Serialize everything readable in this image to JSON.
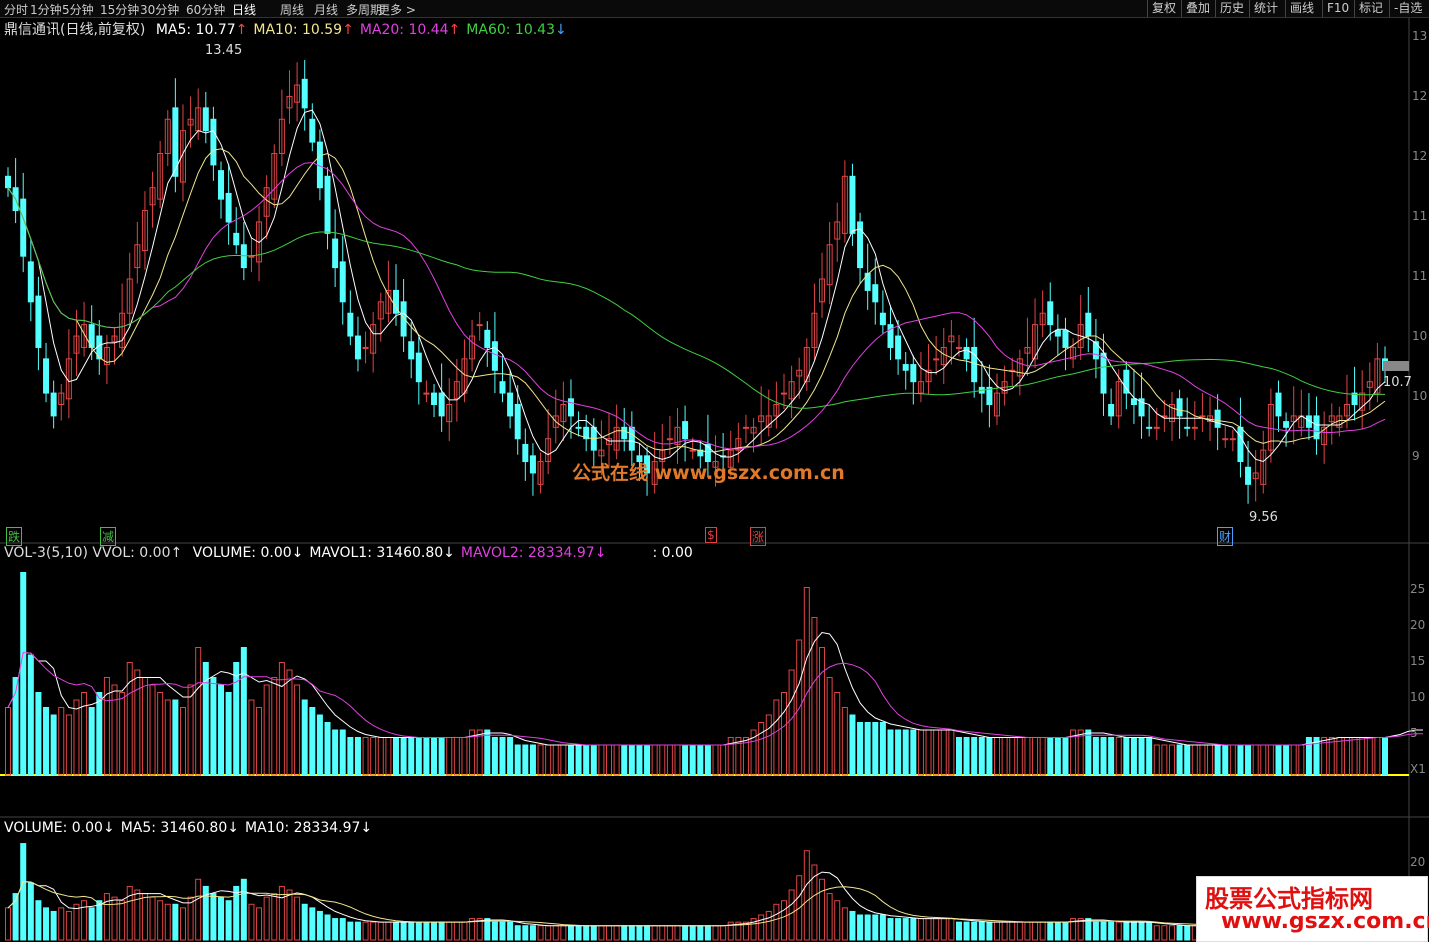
{
  "toolbar": {
    "periods": [
      "分时",
      "1分钟",
      "5分钟",
      "15分钟",
      "30分钟",
      "60分钟",
      "日线",
      "周线",
      "月线",
      "多周期",
      "更多 >"
    ],
    "active_period": "日线",
    "right_buttons": [
      "复权",
      "叠加",
      "历史",
      "统计",
      "画线",
      "F10",
      "标记",
      "-自选"
    ]
  },
  "main_panel": {
    "title": "鼎信通讯(日线,前复权)",
    "ma": [
      {
        "label": "MA5: 10.77",
        "arrow": "↑",
        "color": "#ffffff"
      },
      {
        "label": "MA10: 10.59",
        "arrow": "↑",
        "color": "#f0e68c"
      },
      {
        "label": "MA20: 10.44",
        "arrow": "↑",
        "color": "#e040e0"
      },
      {
        "label": "MA60: 10.43",
        "arrow": "↓",
        "color": "#40d040"
      }
    ],
    "high_label": "13.45",
    "low_label": "9.56",
    "last_label": "10.7",
    "badges": [
      {
        "text": "跌",
        "color": "#40c040"
      },
      {
        "text": "减",
        "color": "#40c040"
      },
      {
        "text": "$",
        "color": "#e04040"
      },
      {
        "text": "涨",
        "color": "#e04040"
      },
      {
        "text": "财",
        "color": "#4aa0ff"
      }
    ],
    "y_ticks": [
      "13",
      "12",
      "12",
      "11",
      "11",
      "10",
      "10",
      "9"
    ]
  },
  "watermark": "公式在线 www.gszx.com.cn",
  "vol3_panel": {
    "title": "VOL-3(5,10) VVOL: 0.00↑",
    "items": [
      {
        "label": "VOLUME: 0.00↓",
        "color": "#ffffff"
      },
      {
        "label": "MAVOL1: 31460.80↓",
        "color": "#ffffff"
      },
      {
        "label": "MAVOL2: 28334.97↓",
        "color": "#e040e0"
      },
      {
        "label": ": 0.00",
        "color": "#ffffff"
      }
    ],
    "y_ticks": [
      "25",
      "20",
      "15",
      "10",
      "5",
      "X1"
    ]
  },
  "vol_panel": {
    "items": [
      {
        "label": "VOLUME: 0.00↓",
        "color": "#ffffff"
      },
      {
        "label": "MA5: 31460.80↓",
        "color": "#ffffff"
      },
      {
        "label": "MA10: 28334.97↓",
        "color": "#ffffff"
      }
    ],
    "y_ticks": [
      "20"
    ]
  },
  "brand": {
    "line1": "股票公式指标网",
    "line2": "www.gszx.com.cn"
  },
  "chart_data": {
    "type": "candlestick",
    "price_ylim": [
      9.3,
      13.7
    ],
    "close": [
      12.3,
      12.1,
      11.7,
      11.3,
      10.9,
      10.5,
      10.3,
      10.5,
      10.8,
      11.0,
      11.1,
      10.9,
      10.8,
      10.9,
      11.0,
      11.2,
      11.5,
      11.8,
      12.1,
      12.3,
      12.6,
      12.9,
      12.4,
      12.8,
      12.9,
      13.0,
      12.8,
      12.5,
      12.2,
      12.0,
      11.8,
      11.6,
      11.7,
      12.0,
      12.3,
      12.6,
      12.9,
      13.1,
      13.2,
      13.0,
      12.7,
      12.3,
      11.9,
      11.6,
      11.3,
      11.0,
      10.8,
      10.9,
      11.1,
      11.3,
      11.4,
      11.2,
      11.0,
      10.8,
      10.6,
      10.5,
      10.4,
      10.3,
      10.4,
      10.6,
      10.8,
      11.0,
      11.1,
      10.9,
      10.7,
      10.5,
      10.3,
      10.1,
      9.9,
      9.8,
      9.9,
      10.1,
      10.3,
      10.4,
      10.3,
      10.2,
      10.1,
      10.0,
      10.0,
      10.1,
      10.2,
      10.1,
      10.0,
      9.9,
      9.8,
      9.9,
      10.0,
      10.1,
      10.2,
      10.1,
      10.0,
      9.95,
      9.9,
      9.9,
      9.95,
      10.0,
      10.1,
      10.2,
      10.2,
      10.3,
      10.3,
      10.4,
      10.5,
      10.6,
      10.7,
      10.9,
      11.2,
      11.5,
      11.8,
      12.0,
      12.4,
      11.9,
      11.6,
      11.4,
      11.3,
      11.1,
      10.9,
      10.8,
      10.7,
      10.6,
      10.6,
      10.7,
      10.8,
      10.9,
      11.0,
      10.9,
      10.8,
      10.6,
      10.5,
      10.4,
      10.5,
      10.6,
      10.7,
      10.8,
      10.9,
      11.1,
      11.2,
      11.1,
      11.0,
      10.9,
      10.9,
      11.1,
      11.0,
      10.8,
      10.5,
      10.3,
      10.6,
      10.5,
      10.4,
      10.3,
      10.2,
      10.2,
      10.3,
      10.4,
      10.3,
      10.2,
      10.2,
      10.3,
      10.3,
      10.2,
      10.1,
      10.1,
      9.9,
      9.7,
      9.8,
      10.0,
      10.4,
      10.3,
      10.2,
      10.3,
      10.3,
      10.2,
      10.1,
      10.2,
      10.3,
      10.3,
      10.4,
      10.4,
      10.5,
      10.6,
      10.8,
      10.7
    ],
    "ma_series": [
      {
        "name": "MA5",
        "color": "#ffffff",
        "window": 5
      },
      {
        "name": "MA10",
        "color": "#f0e68c",
        "window": 10
      },
      {
        "name": "MA20",
        "color": "#e040e0",
        "window": 20
      },
      {
        "name": "MA60",
        "color": "#40d040",
        "window": 60
      }
    ],
    "volume": [
      9,
      13,
      27,
      16,
      11,
      9,
      8,
      9,
      8,
      10,
      11,
      9,
      11,
      13,
      12,
      11,
      15,
      14,
      13,
      12,
      11,
      10,
      10,
      9,
      12,
      17,
      15,
      13,
      12,
      11,
      15,
      17,
      10,
      9,
      12,
      13,
      15,
      14,
      12,
      10,
      9,
      8,
      7,
      6,
      6,
      5,
      5,
      5,
      5,
      5,
      5,
      5,
      5,
      5,
      5,
      5,
      5,
      5,
      5,
      5,
      5,
      6,
      6,
      6,
      5,
      5,
      5,
      4,
      4,
      4,
      4,
      4,
      4,
      4,
      4,
      4,
      4,
      4,
      4,
      4,
      4,
      4,
      4,
      4,
      4,
      4,
      4,
      4,
      4,
      4,
      4,
      4,
      4,
      4,
      4,
      5,
      5,
      5,
      6,
      7,
      8,
      10,
      11,
      14,
      18,
      25,
      21,
      17,
      13,
      11,
      9,
      8,
      7,
      7,
      7,
      7,
      6,
      6,
      6,
      6,
      6,
      6,
      6,
      6,
      6,
      5,
      5,
      5,
      5,
      5,
      5,
      5,
      5,
      5,
      5,
      5,
      5,
      5,
      5,
      5,
      6,
      6,
      6,
      5,
      5,
      5,
      5,
      5,
      5,
      5,
      5,
      4,
      4,
      4,
      4,
      4,
      4,
      4,
      4,
      4,
      4,
      4,
      4,
      4,
      4,
      4,
      4,
      4,
      4,
      4,
      4,
      5,
      5,
      5,
      5,
      5,
      5,
      5,
      5,
      5,
      5,
      5,
      6,
      6,
      7,
      6,
      5
    ]
  }
}
